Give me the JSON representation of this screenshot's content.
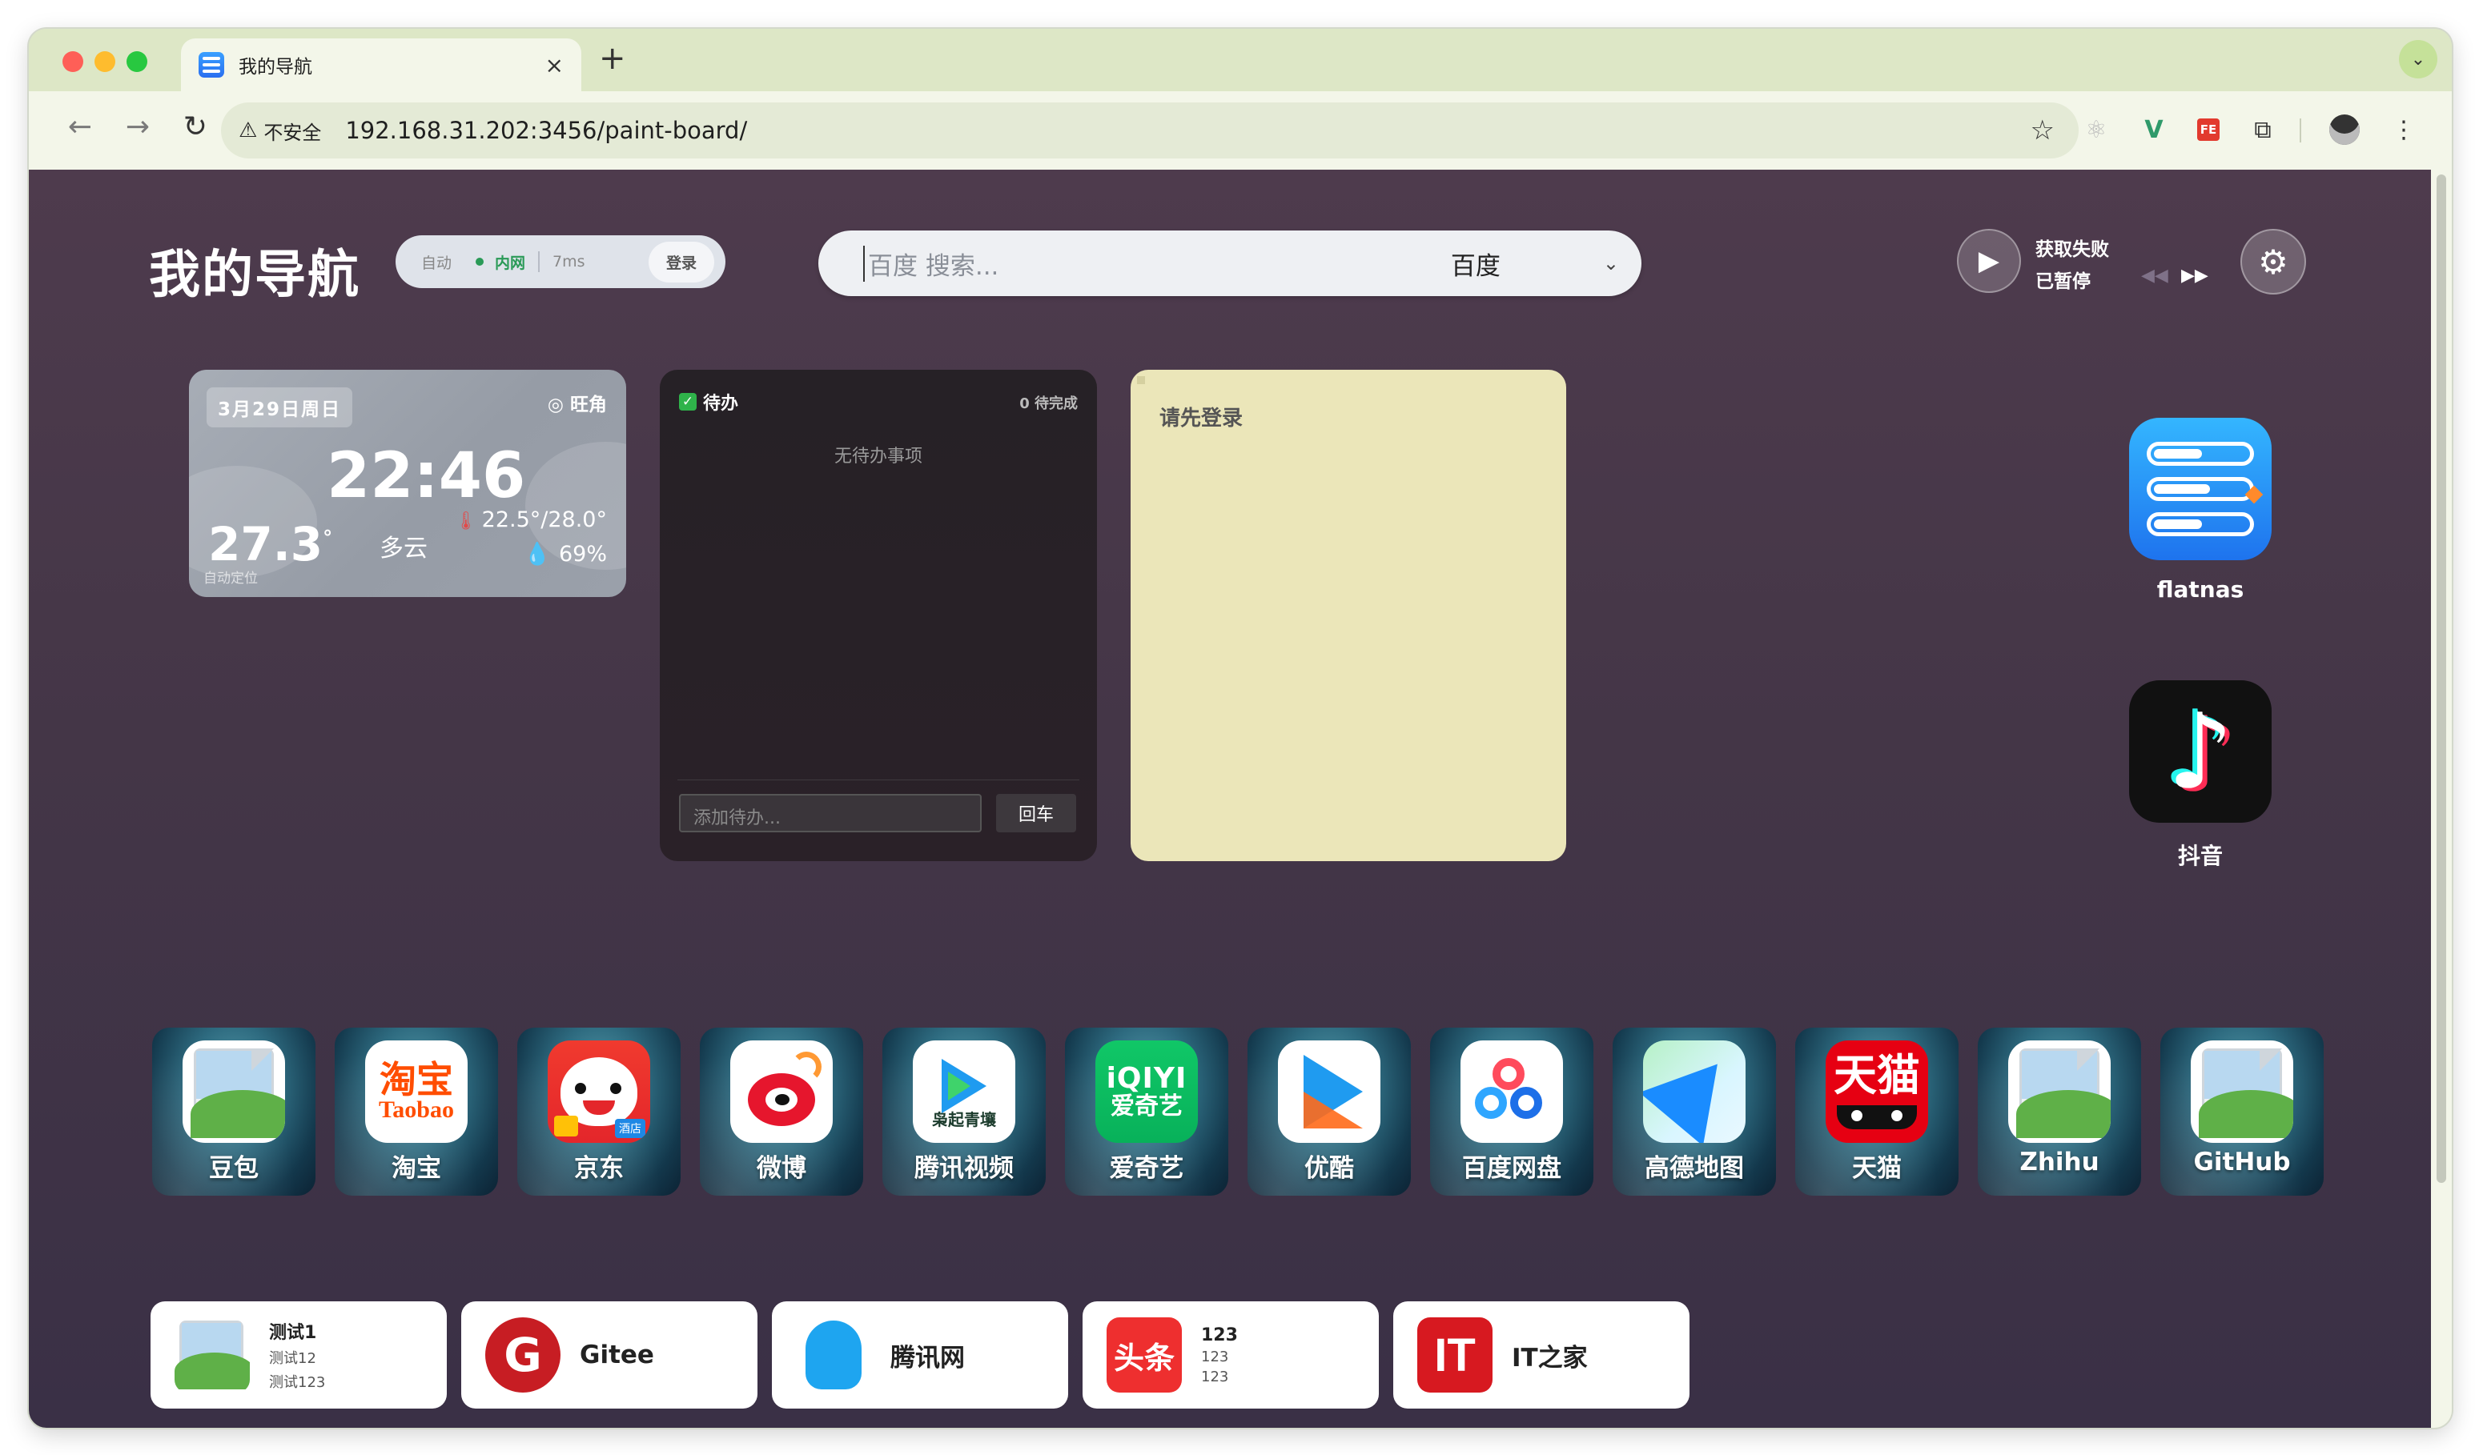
{
  "browser": {
    "tab_title": "我的导航",
    "tab_close": "×",
    "new_tab": "+",
    "tabs_menu": "⌄",
    "back": "←",
    "forward": "→",
    "reload": "↻",
    "security_label": "不安全",
    "url": "192.168.31.202:3456/paint-board/",
    "star": "☆"
  },
  "header": {
    "brand": "我的导航",
    "status": {
      "mode": "自动",
      "network": "内网",
      "latency": "7ms",
      "login": "登录"
    },
    "search": {
      "placeholder": "百度 搜索...",
      "engine": "百度"
    },
    "music": {
      "title": "获取失败",
      "state": "已暂停"
    }
  },
  "weather": {
    "date": "3月29日周日",
    "location": "旺角",
    "time": "22:46",
    "temperature": "27.3",
    "degree": "°",
    "condition": "多云",
    "range": "22.5°/28.0°",
    "humidity": "69%",
    "source": "自动定位"
  },
  "todo": {
    "title": "待办",
    "pending": "0 待完成",
    "empty": "无待办事项",
    "input_placeholder": "添加待办...",
    "enter": "回车"
  },
  "note": {
    "text": "请先登录"
  },
  "side_apps": [
    {
      "label": "flatnas",
      "icon": "flatnas-icon"
    },
    {
      "label": "抖音",
      "icon": "douyin-icon"
    }
  ],
  "apps": [
    {
      "label": "豆包",
      "icon": "image-placeholder-icon"
    },
    {
      "label": "淘宝",
      "icon": "taobao-icon",
      "logo_top": "淘宝",
      "logo_bottom": "Taobao"
    },
    {
      "label": "京东",
      "icon": "jd-icon",
      "badge": "酒店"
    },
    {
      "label": "微博",
      "icon": "weibo-icon"
    },
    {
      "label": "腾讯视频",
      "icon": "tencent-video-icon",
      "logo_text": "枭起青壤"
    },
    {
      "label": "爱奇艺",
      "icon": "iqiyi-icon",
      "logo_top": "iQIYI",
      "logo_bottom": "爱奇艺"
    },
    {
      "label": "优酷",
      "icon": "youku-icon"
    },
    {
      "label": "百度网盘",
      "icon": "baidu-netdisk-icon"
    },
    {
      "label": "高德地图",
      "icon": "amap-icon"
    },
    {
      "label": "天猫",
      "icon": "tmall-icon",
      "logo_text": "天猫"
    },
    {
      "label": "Zhihu",
      "icon": "image-placeholder-icon"
    },
    {
      "label": "GitHub",
      "icon": "image-placeholder-icon"
    }
  ],
  "cards": [
    {
      "title": "测试1",
      "line2": "测试12",
      "line3": "测试123",
      "icon": "image-placeholder-icon"
    },
    {
      "title": "Gitee",
      "icon": "gitee-icon",
      "logo": "G"
    },
    {
      "title": "腾讯网",
      "icon": "qq-icon"
    },
    {
      "title": "123",
      "line2": "123",
      "line3": "123",
      "icon": "toutiao-icon",
      "logo": "头条"
    },
    {
      "title": "IT之家",
      "icon": "ithome-icon",
      "logo": "IT"
    }
  ]
}
